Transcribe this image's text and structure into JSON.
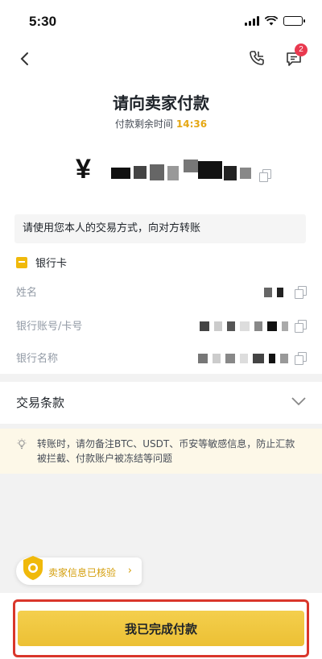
{
  "status_bar": {
    "time": "5:30"
  },
  "header": {
    "notification_count": "2"
  },
  "payment": {
    "title": "请向卖家付款",
    "countdown_label": "付款剩余时间",
    "countdown_value": "14:36",
    "currency_symbol": "¥"
  },
  "notice": "请使用您本人的交易方式，向对方转账",
  "method": {
    "label": "银行卡",
    "fields": [
      {
        "label": "姓名"
      },
      {
        "label": "银行账号/卡号"
      },
      {
        "label": "银行名称"
      }
    ]
  },
  "terms": {
    "label": "交易条款"
  },
  "warning": {
    "text": "转账时，请勿备注BTC、USDT、币安等敏感信息，防止汇款被拦截、付款账户被冻结等问题"
  },
  "verified": {
    "label": "卖家信息已核验"
  },
  "confirm": {
    "label": "我已完成付款"
  },
  "colors": {
    "accent": "#F0B90B",
    "countdown": "#E5A713",
    "badge": "#E9394F",
    "highlight_border": "#D9362B"
  }
}
